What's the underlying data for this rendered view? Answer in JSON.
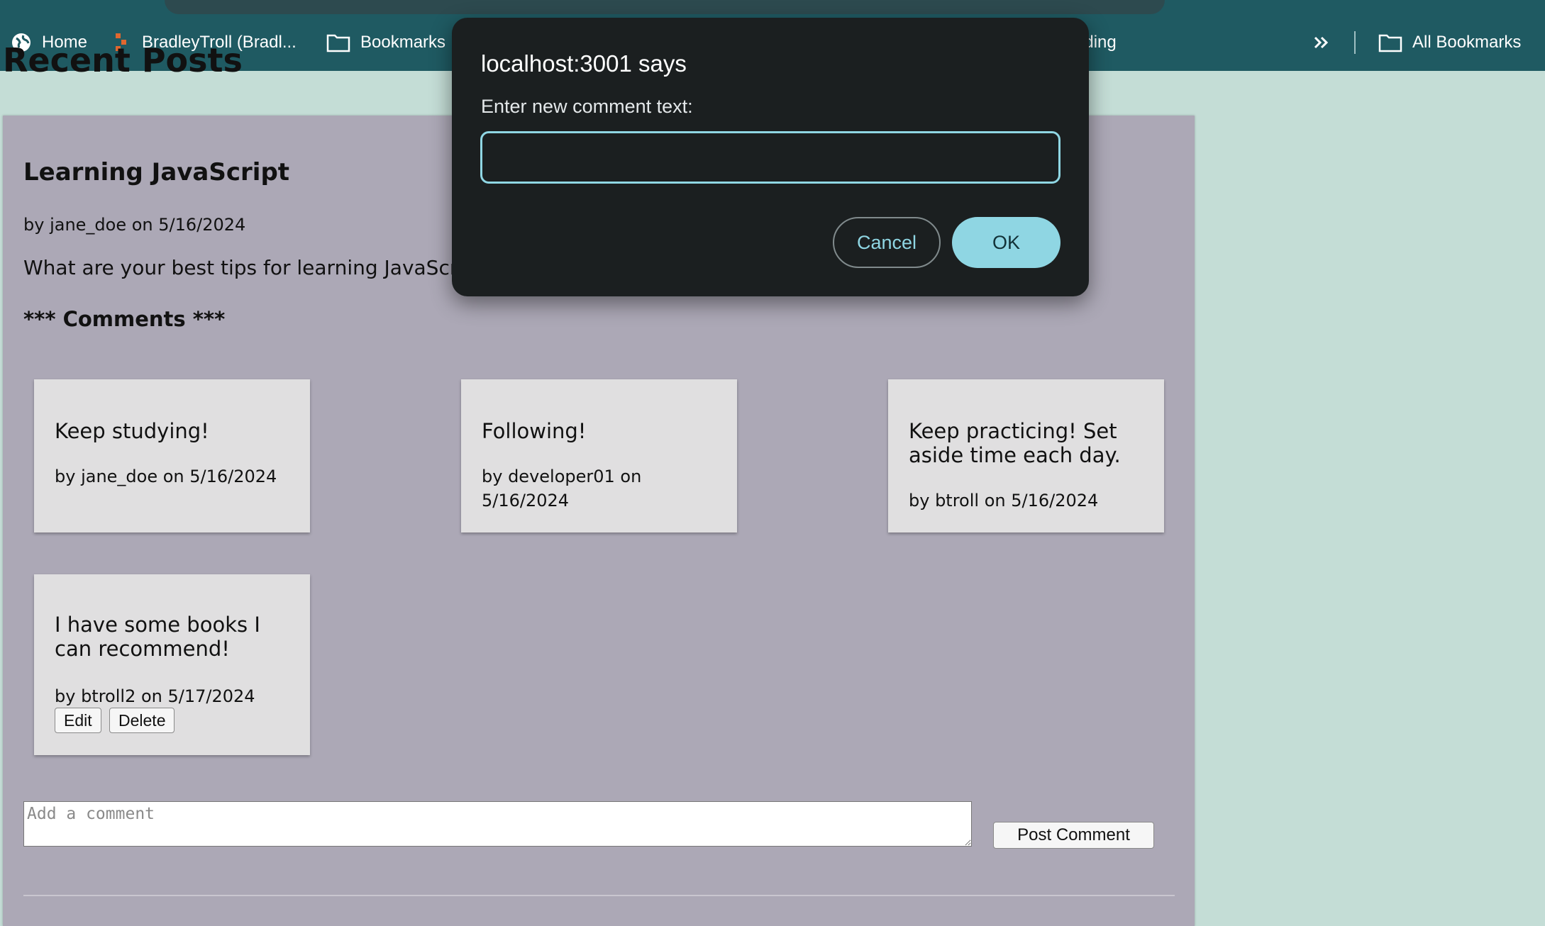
{
  "bookmarks_bar": {
    "items": [
      {
        "label": "Home",
        "icon": "globe-icon"
      },
      {
        "label": "BradleyTroll (Bradl...",
        "icon": "favicon-icon"
      },
      {
        "label": "Bookmarks",
        "icon": "folder-icon"
      },
      {
        "label": "oding",
        "icon": "folder-icon"
      }
    ],
    "overflow_icon": "chevron-double-right-icon",
    "all_bookmarks_label": "All Bookmarks"
  },
  "page": {
    "heading": "Recent Posts"
  },
  "post": {
    "title": "Learning JavaScript",
    "meta": "by jane_doe on 5/16/2024",
    "body": "What are your best tips for learning JavaScript?",
    "comments_heading": "*** Comments ***"
  },
  "comments": [
    {
      "text": "Keep studying!",
      "meta": "by jane_doe on 5/16/2024"
    },
    {
      "text": "Following!",
      "meta": "by developer01 on 5/16/2024"
    },
    {
      "text": "Keep practicing! Set aside time each day.",
      "meta": "by btroll on 5/16/2024"
    },
    {
      "text": "I have some books I can recommend!",
      "meta": "by btroll2 on 5/17/2024",
      "edit_label": "Edit",
      "delete_label": "Delete"
    }
  ],
  "comment_form": {
    "placeholder": "Add a comment",
    "submit_label": "Post Comment"
  },
  "dialog": {
    "title": "localhost:3001 says",
    "prompt": "Enter new comment text:",
    "input_value": "",
    "cancel_label": "Cancel",
    "ok_label": "OK"
  },
  "colors": {
    "page_bg": "#c4ddd6",
    "bookmarks_bar_bg": "#1f5a62",
    "post_card_bg": "#aca8b6",
    "comment_card_bg": "#e0dfe0",
    "dialog_bg": "#1b1f20",
    "dialog_accent": "#8fd6e3"
  }
}
